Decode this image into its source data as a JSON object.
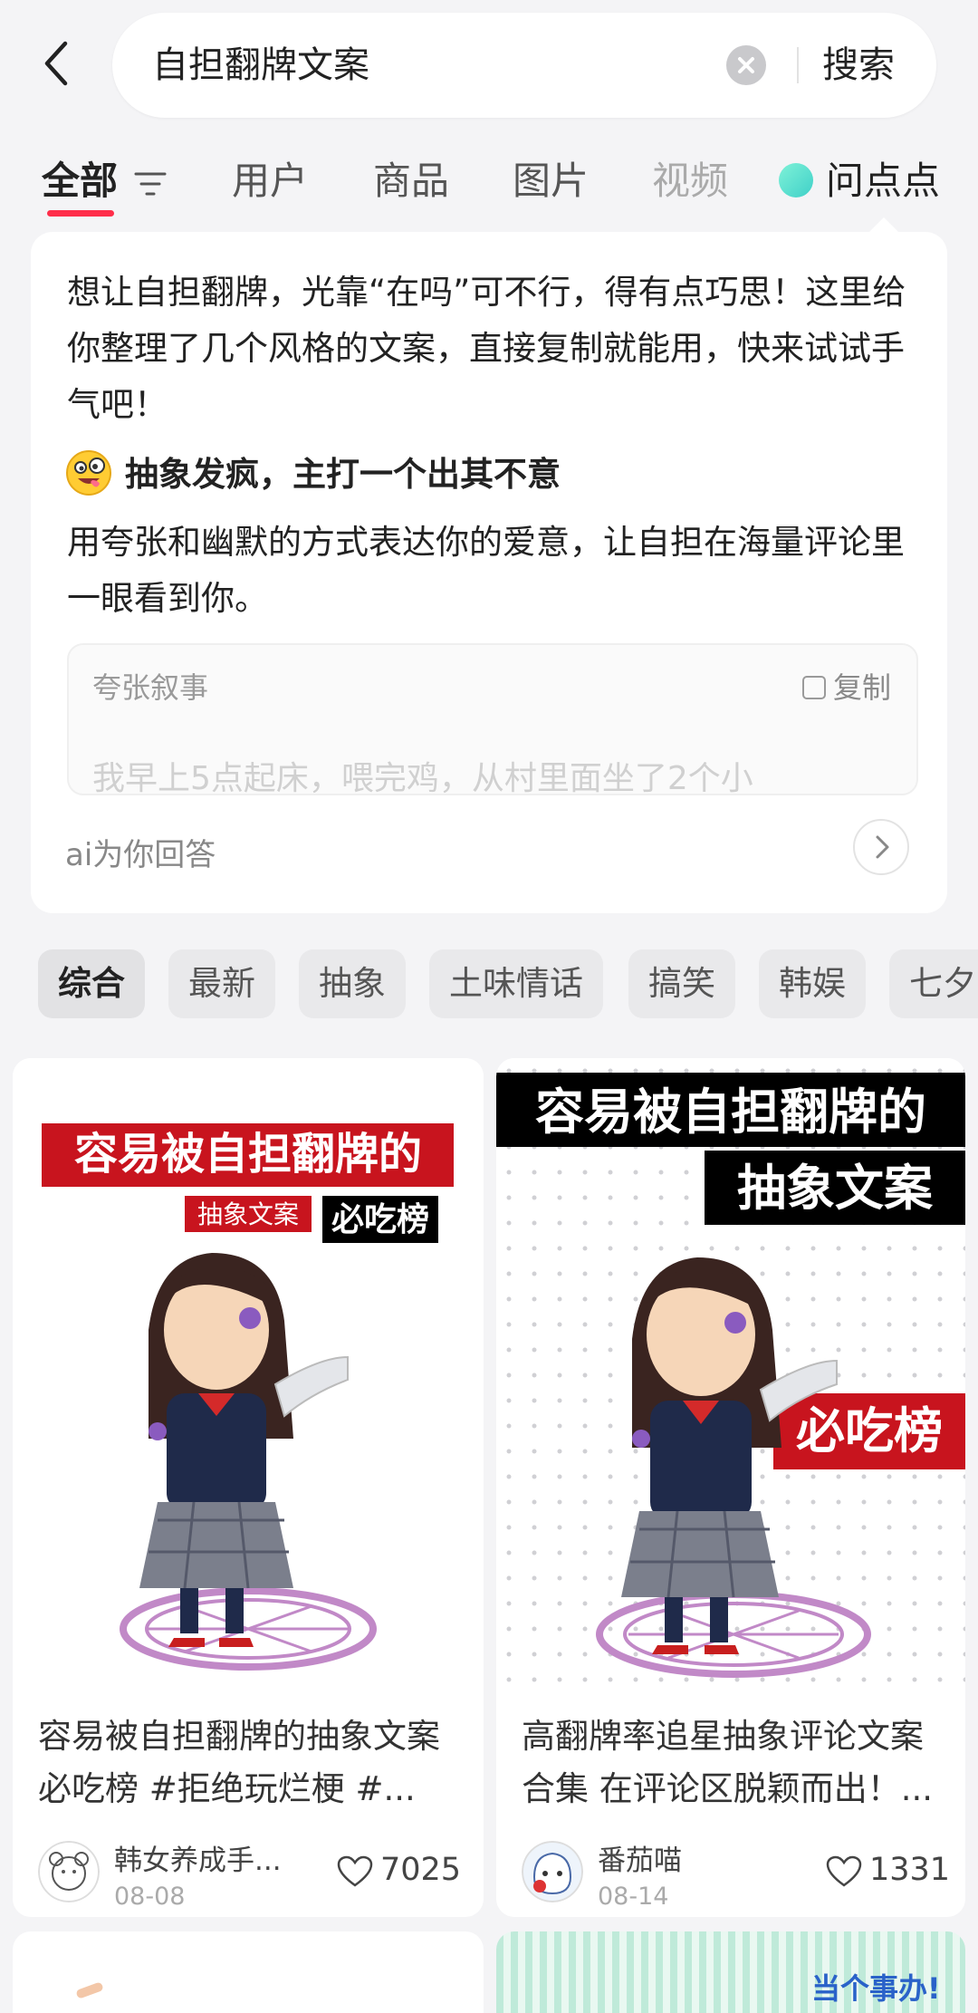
{
  "search": {
    "query": "自担翻牌文案",
    "button": "搜索"
  },
  "tabs": [
    {
      "label": "全部",
      "active": true
    },
    {
      "label": "用户"
    },
    {
      "label": "商品"
    },
    {
      "label": "图片"
    },
    {
      "label": "视频"
    },
    {
      "label": "问点点"
    }
  ],
  "ai_card": {
    "intro": "想让自担翻牌，光靠“在吗”可不行，得有点巧思！这里给你整理了几个风格的文案，直接复制就能用，快来试试手气吧！",
    "section_emoji": "zany-face-icon",
    "section_heading": "抽象发疯，主打一个出其不意",
    "section_desc": "用夸张和幽默的方式表达你的爱意，让自担在海量评论里一眼看到你。",
    "quote_title": "夸张叙事",
    "copy_label": "复制",
    "quote_text": "我早上5点起床，喂完鸡，从村里面坐了2个小",
    "footer": "ai为你回答"
  },
  "chips": [
    "综合",
    "最新",
    "抽象",
    "土味情话",
    "搞笑",
    "韩娱",
    "七夕"
  ],
  "feed": [
    {
      "cover_lines": [
        "容易被自担翻牌的",
        "抽象文案",
        "必吃榜"
      ],
      "title_line1": "容易被自担翻牌的抽象文案",
      "title_line2": "必吃榜 #拒绝玩烂梗  #...",
      "user": "韩女养成手...",
      "date": "08-08",
      "likes": "7025"
    },
    {
      "cover_lines": [
        "容易被自担翻牌的",
        "抽象文案",
        "必吃榜"
      ],
      "title_line1": "高翻牌率追星抽象评论文案",
      "title_line2": "合集 在评论区脱颖而出！...",
      "user": "番茄喵",
      "date": "08-14",
      "likes": "1331"
    }
  ],
  "peek_text": "当个事办!",
  "colors": {
    "accent": "#ff2d4a",
    "cover_red": "#c8141e",
    "bg": "#f4f4f6"
  }
}
